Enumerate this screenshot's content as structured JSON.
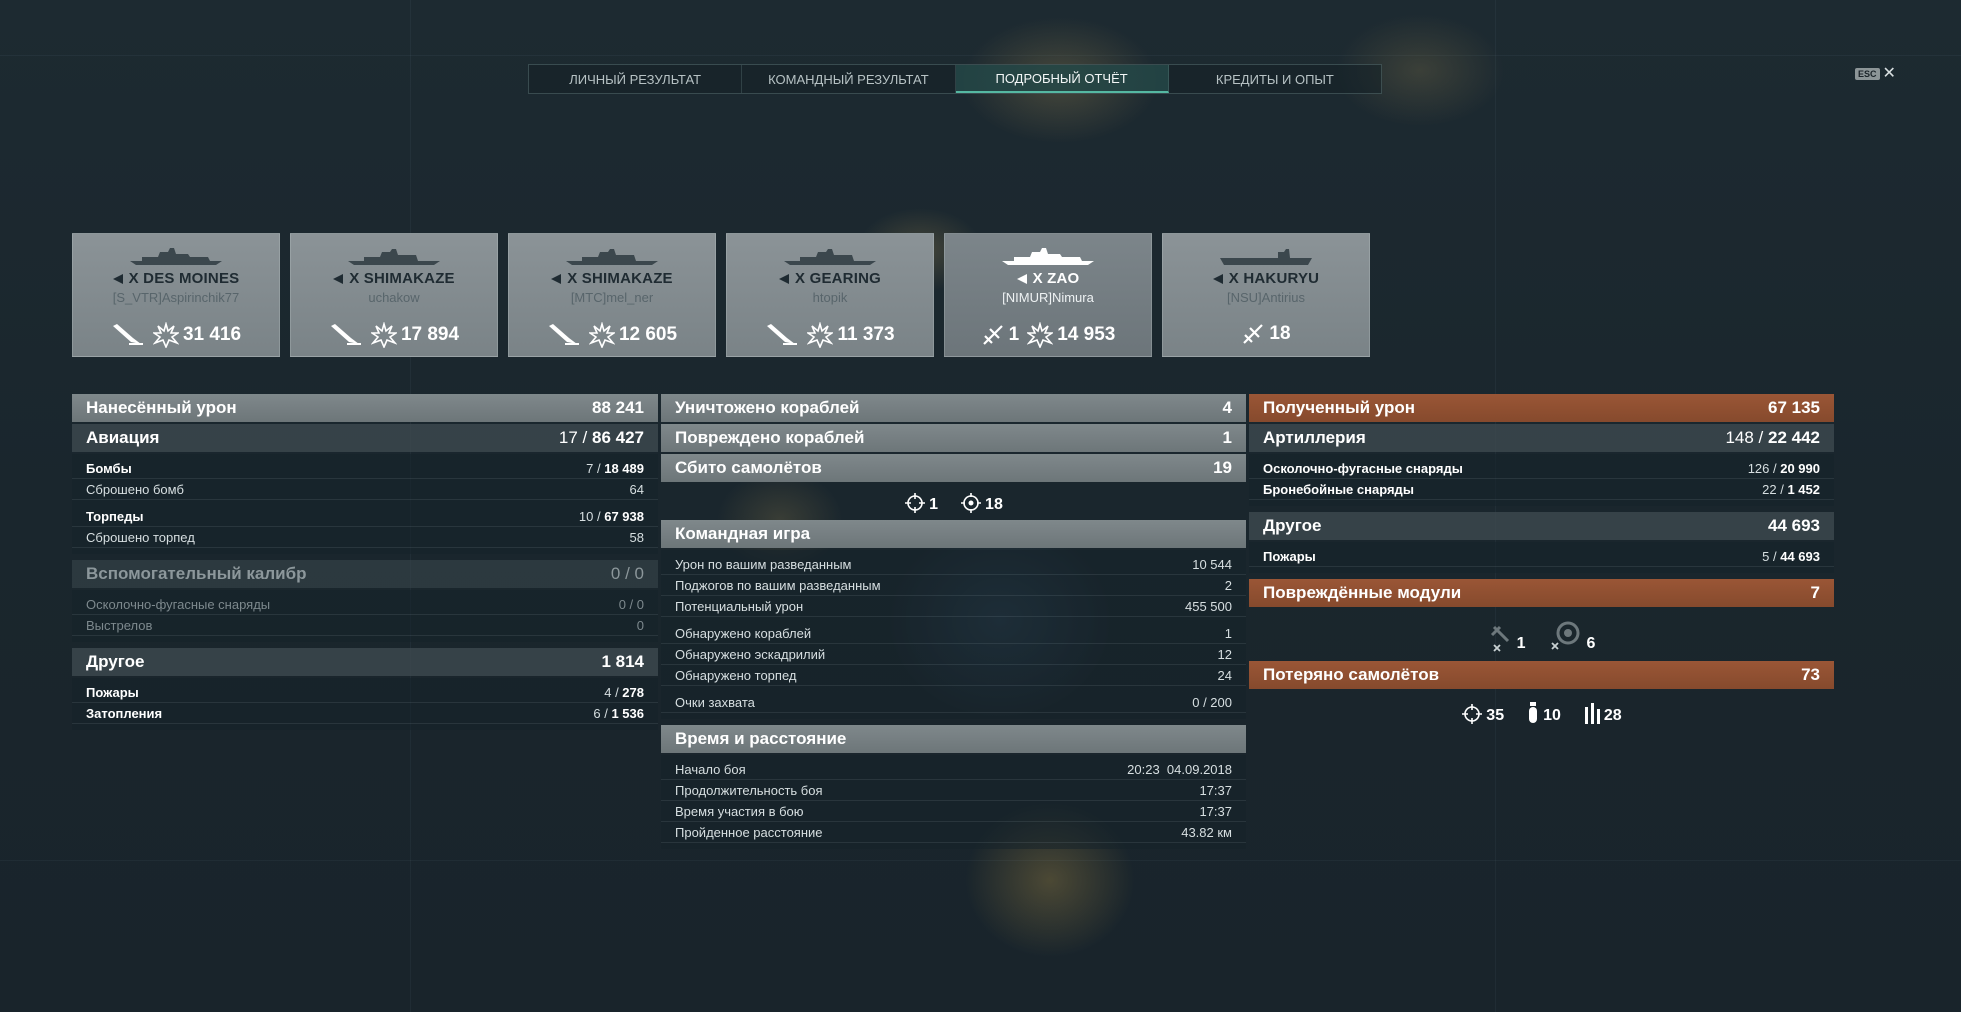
{
  "tabs": [
    {
      "label": "ЛИЧНЫЙ РЕЗУЛЬТАТ"
    },
    {
      "label": "КОМАНДНЫЙ РЕЗУЛЬТАТ"
    },
    {
      "label": "ПОДРОБНЫЙ ОТЧЁТ"
    },
    {
      "label": "КРЕДИТЫ И ОПЫТ"
    }
  ],
  "active_tab": "ПОДРОБНЫЙ ОТЧЁТ",
  "esc_label": "ESC",
  "ships": [
    {
      "name": "X DES MOINES",
      "player": "[S_VTR]Aspirinchik77",
      "kills": "",
      "damage": "31 416"
    },
    {
      "name": "X SHIMAKAZE",
      "player": "uchakow",
      "kills": "",
      "damage": "17 894"
    },
    {
      "name": "X SHIMAKAZE",
      "player": "[MTC]mel_ner",
      "kills": "",
      "damage": "12 605"
    },
    {
      "name": "X GEARING",
      "player": "htopik",
      "kills": "",
      "damage": "11 373"
    },
    {
      "name": "X ZAO",
      "player": "[NIMUR]Nimura",
      "kills": "1",
      "damage": "14 953"
    },
    {
      "name": "X HAKURYU",
      "player": "[NSU]Antirius",
      "kills": "18",
      "damage": ""
    }
  ],
  "damage_dealt": {
    "title": "Нанесённый урон",
    "total": "88 241",
    "aviation": {
      "label": "Авиация",
      "hits": "17",
      "value": "86 427"
    },
    "bombs": {
      "label": "Бомбы",
      "hits": "7",
      "value": "18 489"
    },
    "bombs_dropped": {
      "label": "Сброшено бомб",
      "value": "64"
    },
    "torpedoes": {
      "label": "Торпеды",
      "hits": "10",
      "value": "67 938"
    },
    "torpedoes_dropped": {
      "label": "Сброшено торпед",
      "value": "58"
    },
    "secondary": {
      "label": "Вспомогательный калибр",
      "hits": "0",
      "value": "0"
    },
    "he_shells": {
      "label": "Осколочно-фугасные снаряды",
      "hits": "0",
      "value": "0"
    },
    "shots": {
      "label": "Выстрелов",
      "value": "0"
    },
    "other": {
      "label": "Другое",
      "value": "1 814"
    },
    "fires": {
      "label": "Пожары",
      "hits": "4",
      "value": "278"
    },
    "floods": {
      "label": "Затопления",
      "hits": "6",
      "value": "1 536"
    }
  },
  "center": {
    "destroyed": {
      "label": "Уничтожено кораблей",
      "value": "4"
    },
    "damaged": {
      "label": "Повреждено кораблей",
      "value": "1"
    },
    "planes": {
      "label": "Сбито самолётов",
      "value": "19"
    },
    "planes_icons": {
      "fighters": "1",
      "defense": "18"
    },
    "team": {
      "title": "Командная игра",
      "spot_damage": {
        "label": "Урон по вашим разведанным",
        "value": "10 544"
      },
      "spot_fires": {
        "label": "Поджогов по вашим разведанным",
        "value": "2"
      },
      "potential": {
        "label": "Потенциальный урон",
        "value": "455 500"
      },
      "ships_spotted": {
        "label": "Обнаружено кораблей",
        "value": "1"
      },
      "squadrons_spotted": {
        "label": "Обнаружено эскадрилий",
        "value": "12"
      },
      "torps_spotted": {
        "label": "Обнаружено торпед",
        "value": "24"
      },
      "capture": {
        "label": "Очки захвата",
        "value": "0 / 200"
      }
    },
    "time": {
      "title": "Время и расстояние",
      "start": {
        "label": "Начало боя",
        "value": "20:23  04.09.2018"
      },
      "duration": {
        "label": "Продолжительность боя",
        "value": "17:37"
      },
      "participation": {
        "label": "Время участия в бою",
        "value": "17:37"
      },
      "distance": {
        "label": "Пройденное расстояние",
        "value": "43.82 км"
      }
    }
  },
  "received": {
    "title": "Полученный урон",
    "total": "67 135",
    "artillery": {
      "label": "Артиллерия",
      "hits": "148",
      "value": "22 442"
    },
    "he": {
      "label": "Осколочно-фугасные снаряды",
      "hits": "126",
      "value": "20 990"
    },
    "ap": {
      "label": "Бронебойные снаряды",
      "hits": "22",
      "value": "1 452"
    },
    "other": {
      "label": "Другое",
      "value": "44 693"
    },
    "fires": {
      "label": "Пожары",
      "hits": "5",
      "value": "44 693"
    },
    "modules": {
      "label": "Повреждённые модули",
      "value": "7",
      "steering": "1",
      "engine": "6"
    },
    "planes_lost": {
      "label": "Потеряно самолётов",
      "value": "73",
      "fighters": "35",
      "bombers": "10",
      "torpedo": "28"
    }
  },
  "colors": {
    "accent": "#55b8a2",
    "orange": "#9a5636",
    "panel_gray": "#7f888b"
  }
}
